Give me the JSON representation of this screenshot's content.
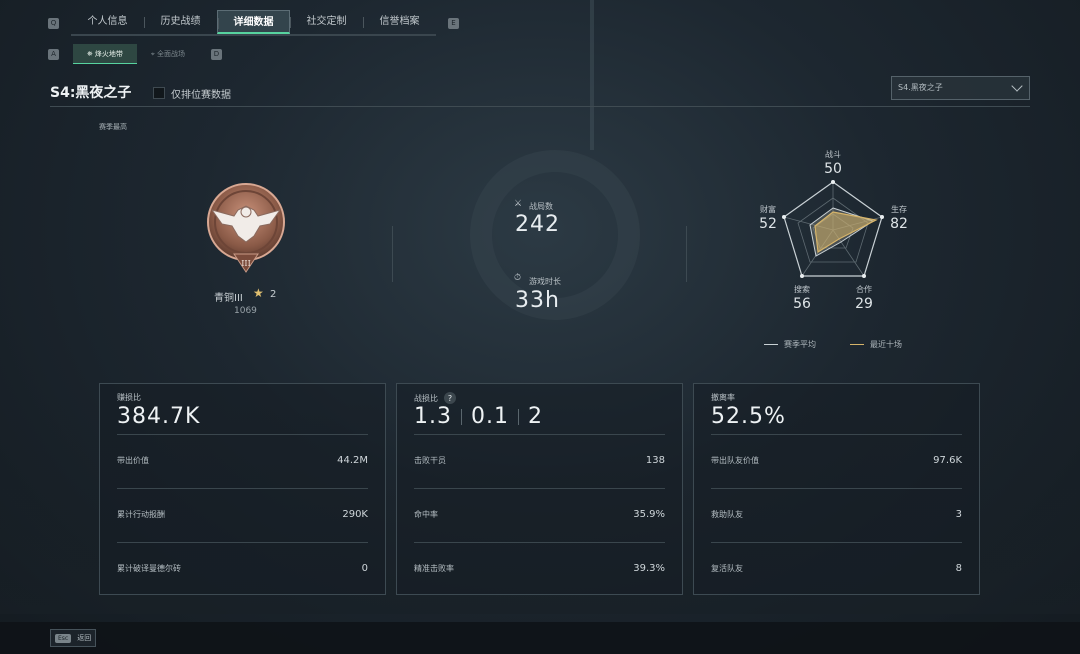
{
  "nav": {
    "left_key": "Q",
    "right_key": "E",
    "tabs": [
      {
        "label": "个人信息"
      },
      {
        "label": "历史战绩"
      },
      {
        "label": "详细数据"
      },
      {
        "label": "社交定制"
      },
      {
        "label": "信誉档案"
      }
    ],
    "active_tab": 2
  },
  "subnav": {
    "left_key": "A",
    "right_key": "D",
    "items": [
      {
        "label": "烽火地带"
      },
      {
        "label": "全面战场"
      }
    ],
    "active_item": 0
  },
  "header": {
    "season_title": "S4:黑夜之子",
    "ranked_only_label": "仅排位赛数据",
    "ranked_only_checked": false,
    "season_select": "S4.黑夜之子"
  },
  "rank": {
    "section_label": "赛季最高",
    "name": "青铜III",
    "stars": "2",
    "score": "1069",
    "tier_roman": "III"
  },
  "summary": {
    "matches_label": "战局数",
    "matches_value": "242",
    "playtime_label": "游戏时长",
    "playtime_value": "33h"
  },
  "radar": {
    "axes": [
      {
        "label": "战斗",
        "value": "50"
      },
      {
        "label": "生存",
        "value": "82"
      },
      {
        "label": "合作",
        "value": "29"
      },
      {
        "label": "搜索",
        "value": "56"
      },
      {
        "label": "财富",
        "value": "52"
      }
    ],
    "legend": [
      {
        "label": "赛季平均",
        "color": "#c9d1d5"
      },
      {
        "label": "最近十场",
        "color": "#d6b46a"
      }
    ]
  },
  "panels": {
    "profit": {
      "title": "赚损比",
      "main": "384.7K",
      "rows": [
        {
          "label": "带出价值",
          "value": "44.2M"
        },
        {
          "label": "累计行动报酬",
          "value": "290K"
        },
        {
          "label": "累计破译曼德尔砖",
          "value": "0"
        }
      ]
    },
    "kd": {
      "title": "战损比",
      "help": "?",
      "main": [
        "1.3",
        "0.1",
        "2"
      ],
      "rows": [
        {
          "label": "击败干员",
          "value": "138"
        },
        {
          "label": "命中率",
          "value": "35.9%"
        },
        {
          "label": "精准击败率",
          "value": "39.3%"
        }
      ]
    },
    "extract": {
      "title": "撤离率",
      "main": "52.5%",
      "rows": [
        {
          "label": "带出队友价值",
          "value": "97.6K"
        },
        {
          "label": "救助队友",
          "value": "3"
        },
        {
          "label": "复活队友",
          "value": "8"
        }
      ]
    }
  },
  "footer": {
    "esc_key": "Esc",
    "back_label": "返回"
  },
  "colors": {
    "accent": "#57d39f",
    "gold": "#d6b46a"
  }
}
